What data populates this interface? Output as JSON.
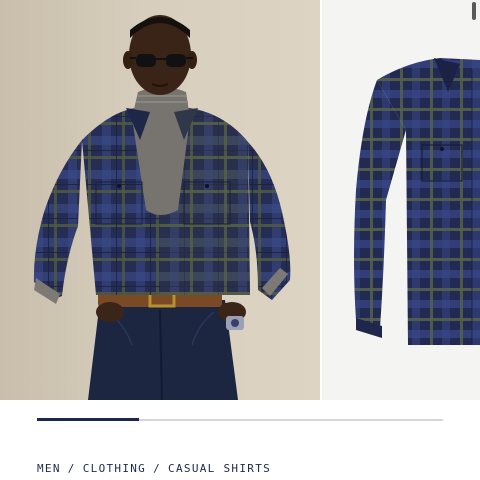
{
  "carousel": {
    "slides": [
      {
        "label": "model-photo"
      },
      {
        "label": "flat-product-photo"
      }
    ],
    "progress_fraction": 0.25
  },
  "breadcrumb": {
    "items": [
      "MEN",
      "CLOTHING",
      "CASUAL SHIRTS"
    ],
    "separator": "/"
  },
  "colors": {
    "accent": "#1b2a4a",
    "track": "#d4d6dc",
    "shirt_navy": "#2a3566",
    "shirt_green": "#3f4a3e"
  }
}
